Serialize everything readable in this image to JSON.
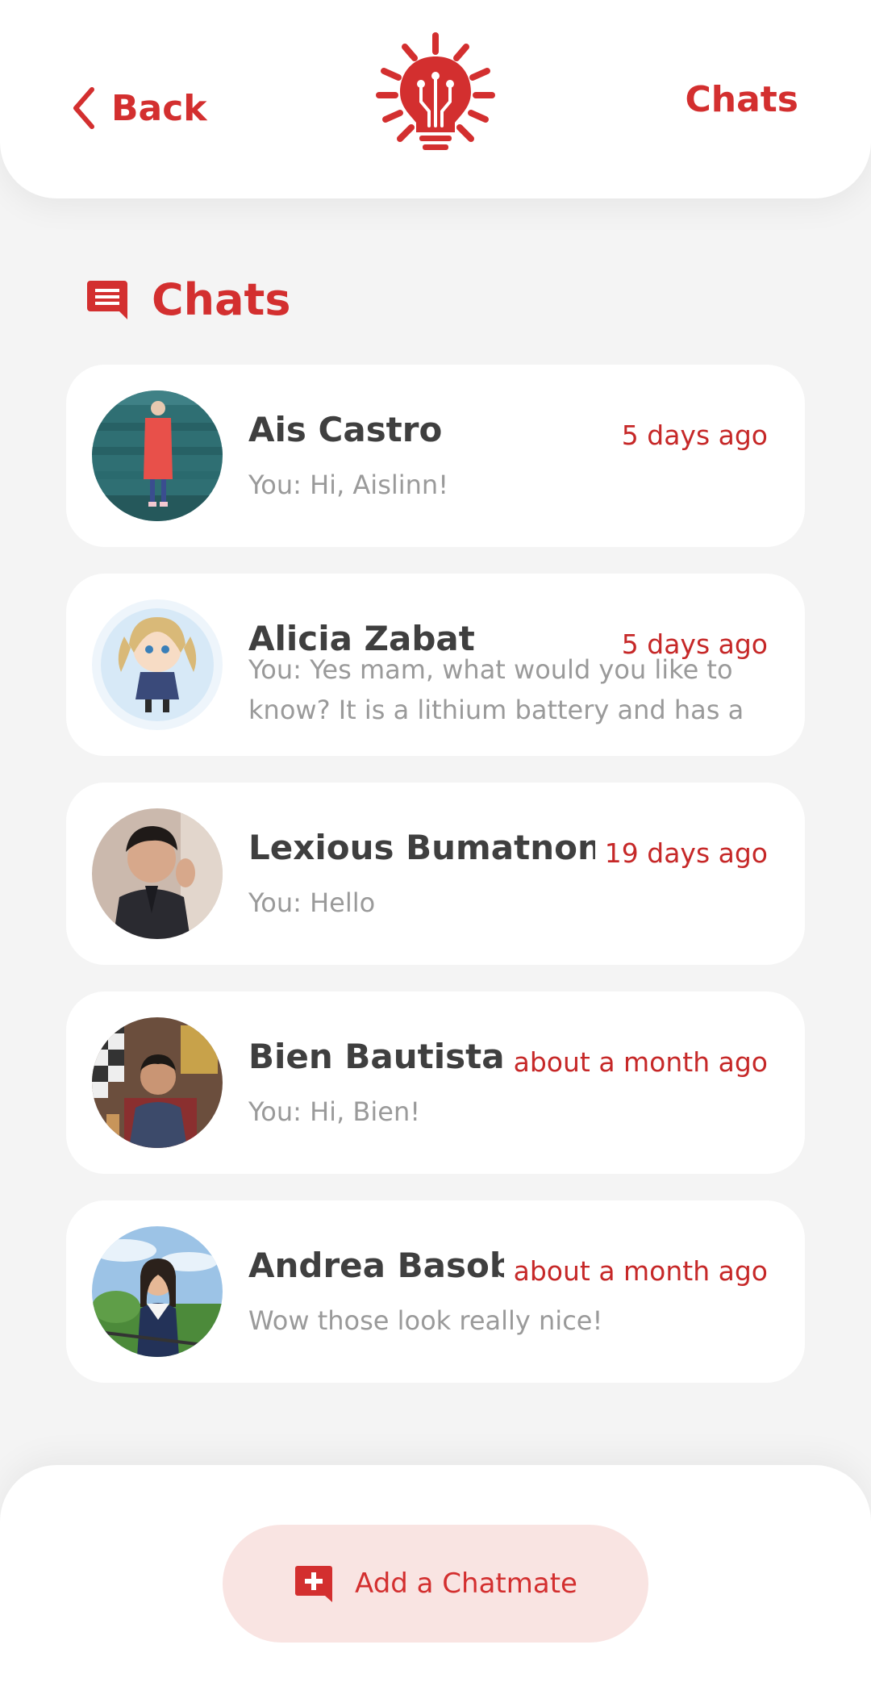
{
  "header": {
    "back_label": "Back",
    "right_label": "Chats"
  },
  "section": {
    "title": "Chats"
  },
  "chats": [
    {
      "name": "Ais Castro",
      "time": "5 days ago",
      "preview": "You: Hi, Aislinn!"
    },
    {
      "name": "Alicia Zabat",
      "time": "5 days ago",
      "preview": "You: Yes mam, what would you like to know? It is a lithium battery and has a"
    },
    {
      "name": "Lexious Bumatnong",
      "time": "19 days ago",
      "preview": "You: Hello"
    },
    {
      "name": "Bien Bautista",
      "time": "about a month ago",
      "preview": "You: Hi, Bien!"
    },
    {
      "name": "Andrea Basob",
      "time": "about a month ago",
      "preview": "Wow those look really nice!"
    }
  ],
  "footer": {
    "add_label": "Add a Chatmate"
  },
  "colors": {
    "accent": "#d32f2f",
    "accent_light": "#f9e4e2",
    "background": "#f4f4f4"
  },
  "icons": {
    "back": "chevron-left-icon",
    "logo": "lightbulb-sun-logo",
    "section": "chat-bubble-icon",
    "add": "add-chat-icon"
  }
}
